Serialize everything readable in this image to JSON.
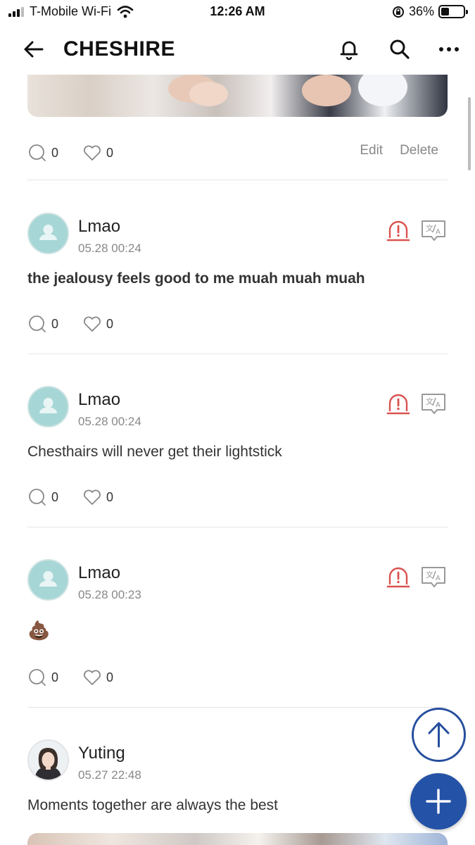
{
  "status_bar": {
    "carrier": "T-Mobile Wi-Fi",
    "time": "12:26 AM",
    "battery": "36%",
    "battery_level": 0.36
  },
  "header": {
    "title": "CHESHIRE",
    "icons": [
      "back-arrow-icon",
      "bell-icon",
      "search-icon",
      "more-icon"
    ]
  },
  "first_post_footer": {
    "comments": "0",
    "likes": "0",
    "edit_label": "Edit",
    "delete_label": "Delete"
  },
  "posts": [
    {
      "author": "Lmao",
      "timestamp": "05.28 00:24",
      "text": "the jealousy feels good to me muah muah muah",
      "comments": "0",
      "likes": "0"
    },
    {
      "author": "Lmao",
      "timestamp": "05.28 00:24",
      "text": "Chesthairs will never get their lightstick",
      "comments": "0",
      "likes": "0"
    },
    {
      "author": "Lmao",
      "timestamp": "05.28 00:23",
      "text": "💩",
      "comments": "0",
      "likes": "0"
    },
    {
      "author": "Yuting",
      "timestamp": "05.27 22:48",
      "text": "Moments together are always the best"
    }
  ],
  "colors": {
    "accent_blue": "#2452a6",
    "report_red": "#d9534f",
    "avatar_teal": "#a7d6d6"
  }
}
